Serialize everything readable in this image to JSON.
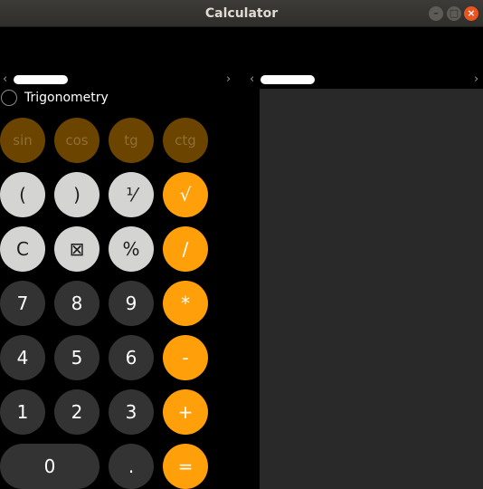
{
  "window": {
    "title": "Calculator",
    "buttons": {
      "minimize": "–",
      "maximize": "□",
      "close": "×"
    }
  },
  "scrollbars": {
    "left_arrow": "‹",
    "right_arrow": "›"
  },
  "trigonometry": {
    "label": "Trigonometry",
    "checked": false
  },
  "keypad": {
    "trig": [
      "sin",
      "cos",
      "tg",
      "ctg"
    ],
    "row1": [
      "(",
      ")",
      "¹⁄",
      "√"
    ],
    "row2": [
      "C",
      "⊠",
      "%",
      "/"
    ],
    "row3": [
      "7",
      "8",
      "9",
      "*"
    ],
    "row4": [
      "4",
      "5",
      "6",
      "-"
    ],
    "row5": [
      "1",
      "2",
      "3",
      "+"
    ],
    "row6": [
      "0",
      ".",
      "="
    ]
  },
  "colors": {
    "accent": "#ff9f0a",
    "function_key": "#d4d4d2",
    "digit_key": "#333333",
    "disabled_key": "#6b4400",
    "panel": "#292929"
  }
}
